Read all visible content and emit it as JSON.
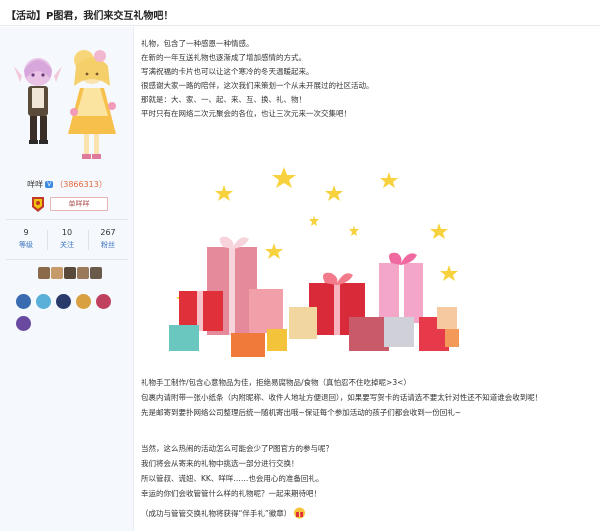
{
  "thread": {
    "title": "【活动】P图君，我们来交互礼物吧！"
  },
  "user": {
    "name": "咩咩",
    "level_badge": "V",
    "uid_display": "（3866313）",
    "title_label": "单咩咩",
    "stats": [
      {
        "value": "9",
        "label": "等级"
      },
      {
        "value": "10",
        "label": "关注"
      },
      {
        "value": "267",
        "label": "粉丝"
      }
    ],
    "small_avatar_colors": [
      "#8a6a4a",
      "#c79a6a",
      "#5a4a3a",
      "#9a7a5a",
      "#6a5a4a"
    ],
    "medal_colors": [
      "#3a6ab0",
      "#5ab0d8",
      "#2a3a6a",
      "#d8a040",
      "#c04060",
      "#6a4aa0"
    ]
  },
  "post": {
    "intro_lines": [
      "礼物，包含了一种感恩一种情感。",
      "在新的一年互送礼物也逐渐成了增加感情的方式。",
      "写满祝福的卡片也可以让这个寒冷的冬天温暖起来。",
      "很感谢大家一路的陪伴，这次我们来策划一个从未开展过的社区活动。",
      "那就是：大、家、一、起、来、互、换、礼、物！",
      "平时只有在网络二次元聚会的各位，也让三次元来一次交集吧！"
    ],
    "rules_lines": [
      "礼物手工制作/包含心意物品为佳，拒绝易腐物品/食物（真怕忍不住吃掉呢>3<）",
      "包裹内请附带一张小纸条（内附昵称、收件人地址方便退回），如果要写贺卡的话请选不要太针对性还不知道谁会收到呢！",
      "先是邮寄到要扑网络公司整理后统一随机寄出哦~保证每个参加活动的孩子们都会收到一份回礼~"
    ],
    "closing_lines": [
      "当然，这么热闹的活动怎么可能会少了P图官方的参与呢？",
      "我们将会从寄来的礼物中挑选一部分进行交换！",
      "所以管叔、谎妞、KK、咩咩……也会用心的准备回礼。",
      "幸运的你们会收管管什么样的礼物呢？一起来期待吧！",
      "（成功与管管交换礼物将获得“伴手礼”徽章）"
    ]
  }
}
